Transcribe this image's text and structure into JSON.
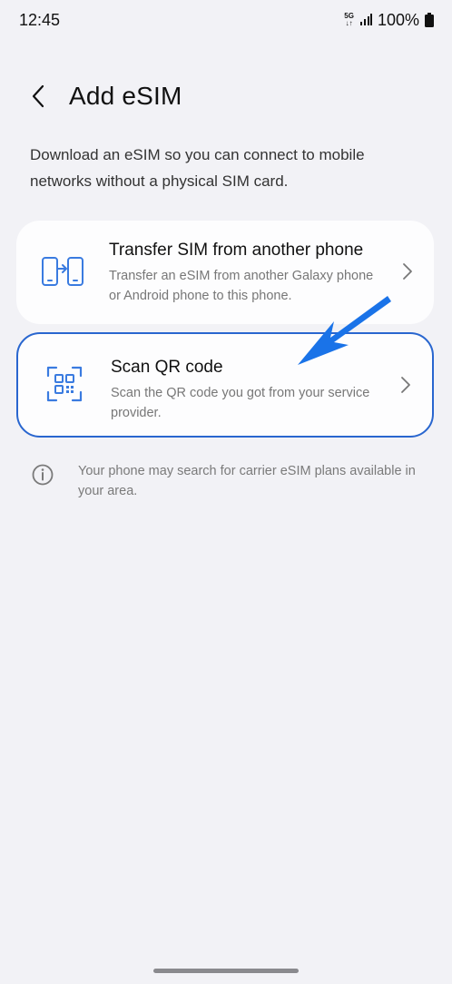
{
  "status_bar": {
    "time": "12:45",
    "network_top": "5G",
    "network_bottom": "↓↑",
    "battery": "100%"
  },
  "header": {
    "back_icon": "chevron-left-icon",
    "title": "Add eSIM"
  },
  "description": "Download an eSIM so you can connect to mobile networks without a physical SIM card.",
  "options": [
    {
      "icon": "phone-transfer-icon",
      "title": "Transfer SIM from another phone",
      "subtitle": "Transfer an eSIM from another Galaxy phone or Android phone to this phone."
    },
    {
      "icon": "qr-scan-icon",
      "title": "Scan QR code",
      "subtitle": "Scan the QR code you got from your service provider.",
      "highlighted": true
    }
  ],
  "info": {
    "icon": "info-icon",
    "text": "Your phone may search for carrier eSIM plans available in your area."
  },
  "colors": {
    "background": "#f2f2f6",
    "card": "#fdfdfe",
    "accent": "#2966cf",
    "icon_blue": "#3a7be0",
    "annotation_arrow": "#1a73e8"
  }
}
